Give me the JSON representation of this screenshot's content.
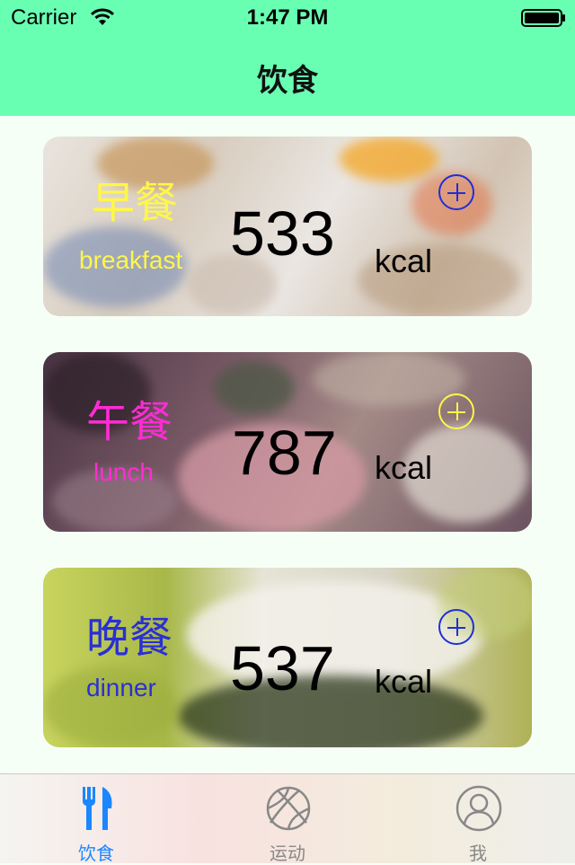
{
  "status": {
    "carrier": "Carrier",
    "time": "1:47 PM"
  },
  "nav": {
    "title": "饮食"
  },
  "meals": [
    {
      "name_cn": "早餐",
      "name_en": "breakfast",
      "kcal": "533",
      "unit": "kcal",
      "label_color": "#fff64b",
      "add_color": "#1f2fd6"
    },
    {
      "name_cn": "午餐",
      "name_en": "lunch",
      "kcal": "787",
      "unit": "kcal",
      "label_color": "#ff2bd6",
      "add_color": "#fff64b"
    },
    {
      "name_cn": "晚餐",
      "name_en": "dinner",
      "kcal": "537",
      "unit": "kcal",
      "label_color": "#2a2fd6",
      "add_color": "#1f2fd6"
    }
  ],
  "tabs": [
    {
      "label": "饮食",
      "icon": "fork-knife-icon",
      "active": true
    },
    {
      "label": "运动",
      "icon": "basketball-icon",
      "active": false
    },
    {
      "label": "我",
      "icon": "person-icon",
      "active": false
    }
  ],
  "colors": {
    "accent": "#69ffb3",
    "tab_active": "#1a87ff",
    "tab_inactive": "#888888"
  }
}
